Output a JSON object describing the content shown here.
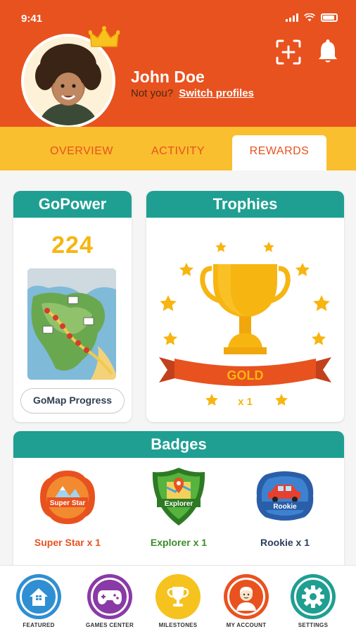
{
  "status_bar": {
    "time": "9:41"
  },
  "profile": {
    "name": "John Doe",
    "not_you": "Not you?",
    "switch_label": "Switch profiles"
  },
  "tabs": [
    {
      "label": "OVERVIEW",
      "active": false
    },
    {
      "label": "ACTIVITY",
      "active": false
    },
    {
      "label": "REWARDS",
      "active": true
    }
  ],
  "gopower": {
    "title": "GoPower",
    "value": "224",
    "button_label": "GoMap Progress"
  },
  "trophies": {
    "title": "Trophies",
    "level": "GOLD",
    "count": "x 1"
  },
  "badges": {
    "title": "Badges",
    "items": [
      {
        "emblem": "Super Star",
        "label": "Super Star x 1",
        "color": "#e8521f"
      },
      {
        "emblem": "Explorer",
        "label": "Explorer x 1",
        "color": "#3c8c2c"
      },
      {
        "emblem": "Rookie",
        "label": "Rookie x 1",
        "color": "#2b3f5c"
      }
    ]
  },
  "bottom_nav": [
    {
      "label": "FEATURED",
      "icon": "house-icon",
      "color": "#2f8fd2"
    },
    {
      "label": "GAMES CENTER",
      "icon": "gamepad-icon",
      "color": "#8a3aa6"
    },
    {
      "label": "MILESTONES",
      "icon": "trophy-icon",
      "color": "#f6c21e"
    },
    {
      "label": "MY ACCOUNT",
      "icon": "account-icon",
      "color": "#e8521f"
    },
    {
      "label": "SETTINGS",
      "icon": "gear-icon",
      "color": "#1e9f92"
    }
  ],
  "colors": {
    "header": "#e8521f",
    "tab_bar": "#f9bf2f",
    "accent_teal": "#1e9f92",
    "gold": "#f7b511"
  }
}
